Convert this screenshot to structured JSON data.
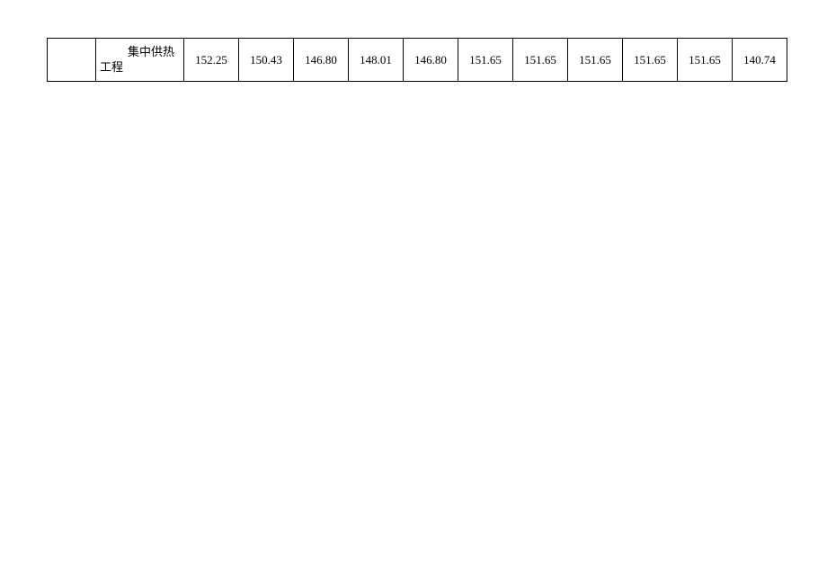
{
  "table": {
    "row": {
      "label_line1": "集中供热",
      "label_line2": "工程",
      "values": [
        "152.25",
        "150.43",
        "146.80",
        "148.01",
        "146.80",
        "151.65",
        "151.65",
        "151.65",
        "151.65",
        "151.65",
        "140.74"
      ]
    }
  }
}
